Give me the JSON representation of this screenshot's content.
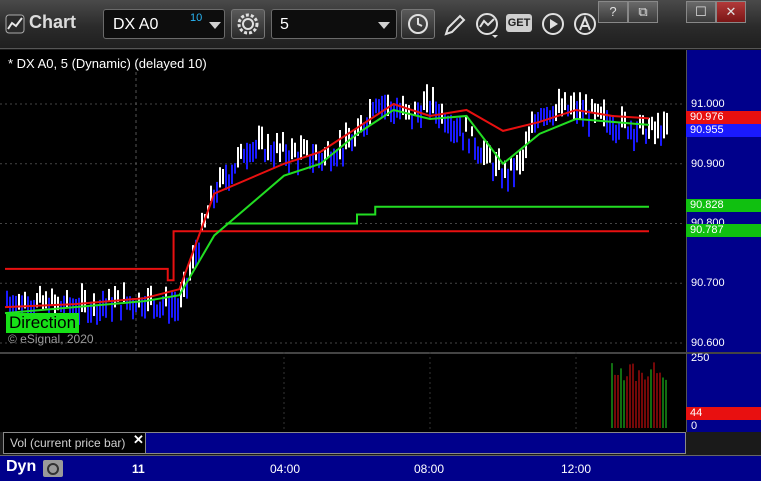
{
  "window": {
    "title": "Chart",
    "controls": [
      "?",
      "⧉",
      "☐",
      "✕"
    ]
  },
  "toolbar": {
    "symbol": "DX A0",
    "symbol_superscript": "10",
    "interval": "5",
    "icons": [
      "gear-icon",
      "clock-icon",
      "pencil-icon",
      "indicator-icon",
      "get-icon",
      "play-icon",
      "alert-icon"
    ],
    "get_label": "GET"
  },
  "chart": {
    "title": "* DX A0, 5 (Dynamic) (delayed 10)",
    "copyright": "© eSignal, 2020",
    "direction_label": "Direction",
    "price_ticks": [
      "91.000",
      "90.900",
      "90.800",
      "90.700",
      "90.600"
    ],
    "markers": [
      {
        "label": "90.976",
        "color": "#e81010"
      },
      {
        "label": "90.955",
        "color": "#1a1aff"
      },
      {
        "label": "90.828",
        "color": "#10c010"
      },
      {
        "label": "90.787",
        "color": "#10c010"
      }
    ],
    "colors": {
      "up_bar": "#ffffff",
      "down_bar": "#1a1aff",
      "ma_red": "#e81010",
      "ma_green": "#22dd22",
      "axis_bg": "#00008b"
    }
  },
  "volume": {
    "label": "Vol (current price bar)",
    "ticks": [
      "250",
      "0"
    ],
    "current_marker": "44"
  },
  "time_axis": {
    "mode_button": "Dyn",
    "date_label": "11",
    "ticks": [
      "04:00",
      "08:00",
      "12:00"
    ]
  },
  "chart_data": {
    "type": "line",
    "title": "* DX A0, 5 (Dynamic) (delayed 10)",
    "y_range": [
      90.6,
      91.04
    ],
    "x_ticks": [
      "11",
      "04:00",
      "08:00",
      "12:00"
    ],
    "y_ticks": [
      91.0,
      90.9,
      90.8,
      90.7,
      90.6
    ],
    "series": [
      {
        "name": "",
        "type": "step",
        "color": "#e81010",
        "x": [
          "00:00",
          "01:30",
          "02:20",
          "02:25",
          "14:00"
        ],
        "values": [
          90.724,
          90.724,
          90.705,
          90.787,
          90.787
        ]
      },
      {
        "name": "",
        "type": "step",
        "color": "#22dd22",
        "x": [
          "03:10",
          "04:00",
          "06:00",
          "06:30",
          "14:00"
        ],
        "values": [
          90.8,
          90.8,
          90.815,
          90.828,
          90.828
        ]
      },
      {
        "name": "",
        "type": "line",
        "color": "#e81010",
        "x": [
          "00:00",
          "01:00",
          "02:00",
          "02:30",
          "03:00",
          "04:00",
          "05:00",
          "06:00",
          "07:00",
          "08:00",
          "09:00",
          "10:00",
          "11:00",
          "12:00",
          "13:00",
          "14:00"
        ],
        "values": [
          90.66,
          90.665,
          90.675,
          90.69,
          90.85,
          90.9,
          90.92,
          90.96,
          91.0,
          90.98,
          90.99,
          90.955,
          90.97,
          90.99,
          90.98,
          90.976
        ]
      },
      {
        "name": "",
        "type": "line",
        "color": "#22dd22",
        "x": [
          "00:00",
          "01:00",
          "02:00",
          "02:30",
          "03:00",
          "04:00",
          "05:00",
          "06:00",
          "07:00",
          "08:00",
          "09:00",
          "10:00",
          "11:00",
          "12:00",
          "13:00",
          "14:00"
        ],
        "values": [
          90.65,
          90.66,
          90.67,
          90.68,
          90.78,
          90.88,
          90.9,
          90.95,
          90.99,
          90.975,
          90.98,
          90.9,
          90.95,
          90.975,
          90.97,
          90.965
        ]
      }
    ],
    "price_bars": {
      "x": [
        "00:00",
        "01:00",
        "02:00",
        "02:30",
        "03:00",
        "03:30",
        "04:00",
        "05:00",
        "06:00",
        "06:30",
        "07:00",
        "07:30",
        "08:00",
        "09:00",
        "10:00",
        "10:30",
        "11:00",
        "12:00",
        "13:00",
        "14:00"
      ],
      "close": [
        90.67,
        90.66,
        90.672,
        90.66,
        90.85,
        90.93,
        90.92,
        90.91,
        90.94,
        91.01,
        90.99,
        90.98,
        91.0,
        90.95,
        90.88,
        90.9,
        90.99,
        90.99,
        90.97,
        90.955
      ]
    },
    "volume": {
      "ylim": [
        0,
        250
      ],
      "last": 44
    }
  }
}
